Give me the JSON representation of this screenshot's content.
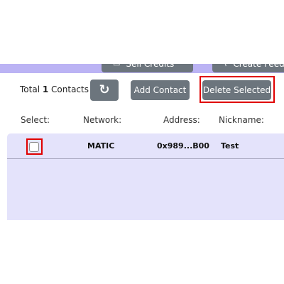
{
  "top_buttons": {
    "sell_credits": {
      "label": "Sell Credits",
      "icon": "card-icon"
    },
    "create_feed": {
      "label": "Create Feed",
      "icon": "rss-icon"
    }
  },
  "toolbar": {
    "total_prefix": "Total",
    "total_count": "1",
    "total_suffix": "Contacts",
    "refresh_icon": "refresh-icon",
    "add_contact_label": "Add Contact",
    "delete_selected_label": "Delete Selected"
  },
  "table": {
    "headers": [
      "Select:",
      "Network:",
      "Address:",
      "Nickname:"
    ],
    "rows": [
      {
        "selected": false,
        "network": "MATIC",
        "address": "0x989...B00",
        "nickname": "Test"
      }
    ]
  },
  "colors": {
    "accent_strip": "#bbb3f4",
    "button_bg": "#6c757d",
    "table_bg": "#e4e3fb",
    "highlight": "#e00000"
  }
}
